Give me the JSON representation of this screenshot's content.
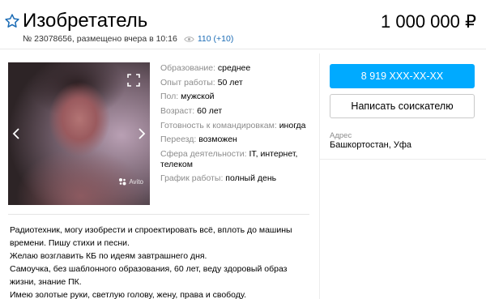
{
  "header": {
    "title": "Изобретатель",
    "price": "1 000 000 ₽",
    "meta": "№ 23078656, размещено вчера в 10:16",
    "views_total": "110",
    "views_today": "(+10)"
  },
  "photo": {
    "watermark": "Avito"
  },
  "params": [
    {
      "label": "Образование:",
      "value": "среднее"
    },
    {
      "label": "Опыт работы:",
      "value": "50 лет"
    },
    {
      "label": "Пол:",
      "value": "мужской"
    },
    {
      "label": "Возраст:",
      "value": "60 лет"
    },
    {
      "label": "Готовность к командировкам:",
      "value": "иногда"
    },
    {
      "label": "Переезд:",
      "value": "возможен"
    },
    {
      "label": "Сфера деятельности:",
      "value": "IT, интернет, телеком"
    },
    {
      "label": "График работы:",
      "value": "полный день"
    }
  ],
  "contact": {
    "phone_label": "8 919 XXX-XX-XX",
    "write_label": "Написать соискателю",
    "address_label": "Адрес",
    "address_value": "Башкортостан, Уфа"
  },
  "description": [
    "Радиотехник, могу изобрести и спроектировать всё, вплоть до машины времени. Пишу стихи и песни.",
    "Желаю возглавить КБ по идеям завтрашнего дня.",
    "Самоучка, без шаблонного образования, 60 лет, веду здоровый образ жизни, знание ПК.",
    "Имею золотые руки, светлую голову, жену, права и свободу."
  ],
  "colors": {
    "accent": "#00aaff",
    "link": "#1a6bb5",
    "muted": "#8c8c8c"
  }
}
